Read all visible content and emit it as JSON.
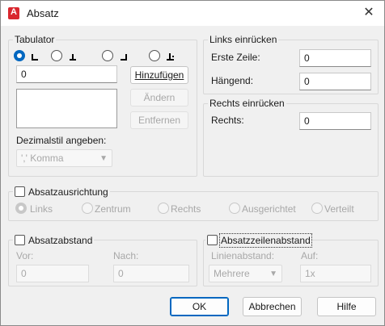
{
  "window": {
    "title": "Absatz",
    "app_icon_letter": "A",
    "close_glyph": "✕"
  },
  "tabulator": {
    "title": "Tabulator",
    "value": "0",
    "add_button": "Hinzufügen",
    "change_button": "Ändern",
    "remove_button": "Entfernen",
    "decimal_label": "Dezimalstil angeben:",
    "decimal_value": "',' Komma",
    "tab_types": [
      "left-tab",
      "center-tab",
      "right-tab",
      "decimal-tab"
    ]
  },
  "indent_left": {
    "title": "Links einrücken",
    "first_line_label": "Erste Zeile:",
    "first_line_value": "0",
    "hanging_label": "Hängend:",
    "hanging_value": "0"
  },
  "indent_right": {
    "title": "Rechts einrücken",
    "right_label": "Rechts:",
    "right_value": "0"
  },
  "alignment": {
    "title": "Absatzausrichtung",
    "options": [
      "Links",
      "Zentrum",
      "Rechts",
      "Ausgerichtet",
      "Verteilt"
    ]
  },
  "spacing": {
    "title": "Absatzabstand",
    "before_label": "Vor:",
    "before_value": "0",
    "after_label": "Nach:",
    "after_value": "0"
  },
  "line_spacing": {
    "title": "Absatzzeilenabstand",
    "spacing_label": "Linienabstand:",
    "spacing_value": "Mehrere",
    "at_label": "Auf:",
    "at_value": "1x"
  },
  "buttons": {
    "ok": "OK",
    "cancel": "Abbrechen",
    "help": "Hilfe"
  }
}
